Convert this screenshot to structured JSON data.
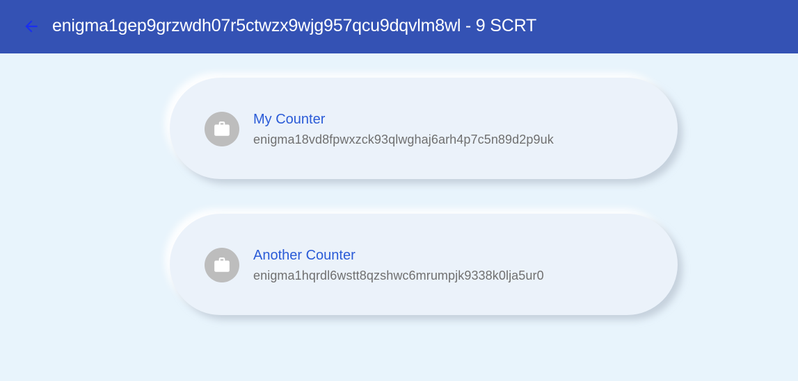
{
  "app_bar": {
    "title": "enigma1gep9grzwdh07r5ctwzx9wjg957qcu9dqvlm8wl - 9 SCRT",
    "back_icon": "arrow-left-icon",
    "background": "#3452b4"
  },
  "contracts": [
    {
      "name": "My Counter",
      "address": "enigma18vd8fpwxzck93qlwghaj6arh4p7c5n89d2p9uk",
      "icon": "briefcase-icon"
    },
    {
      "name": "Another Counter",
      "address": "enigma1hqrdl6wstt8qzshwc6mrumpjk9338k0lja5ur0",
      "icon": "briefcase-icon"
    }
  ],
  "colors": {
    "accent": "#2a5bd7",
    "page_background": "#e8f4fc",
    "avatar": "#bdbdbd"
  }
}
